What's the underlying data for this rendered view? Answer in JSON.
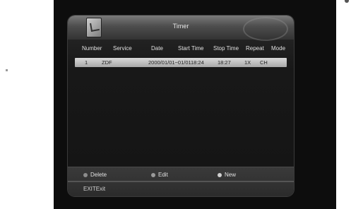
{
  "app": {
    "title": "Timer"
  },
  "columns": [
    "Number",
    "Service",
    "Date",
    "Start Time",
    "Stop Time",
    "Repeat",
    "Mode"
  ],
  "rows": [
    {
      "number": "1",
      "service": "ZDF",
      "date": "2000/01/01~01/01",
      "start": "18:24",
      "stop": "18:27",
      "repeat": "1X",
      "mode": "CH"
    }
  ],
  "footer": {
    "delete_label": "Delete",
    "edit_label": "Edit",
    "new_label": "New",
    "exit_key": "EXIT",
    "exit_label": "Exit"
  },
  "colors": {
    "delete_dot": "#8c8c8c",
    "edit_dot": "#9a9a9a",
    "new_dot": "#d0d0d0"
  }
}
